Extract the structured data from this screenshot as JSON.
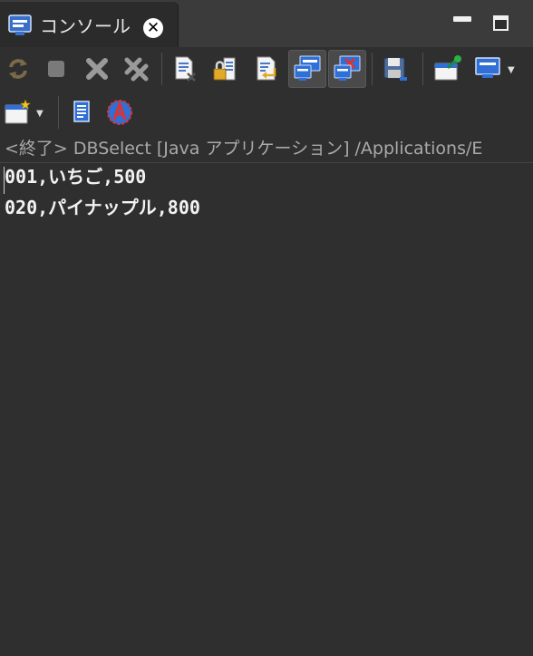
{
  "tab": {
    "title": "コンソール",
    "close_glyph": "✕"
  },
  "console": {
    "status": "<終了> DBSelect [Java アプリケーション] /Applications/E",
    "lines": [
      "001,いちご,500",
      "020,パイナップル,800"
    ]
  },
  "colors": {
    "background": "#2f2f2f",
    "tab_active": "#2b2b2b",
    "accent_blue": "#2f6fd6",
    "close_red": "#e0312e"
  }
}
